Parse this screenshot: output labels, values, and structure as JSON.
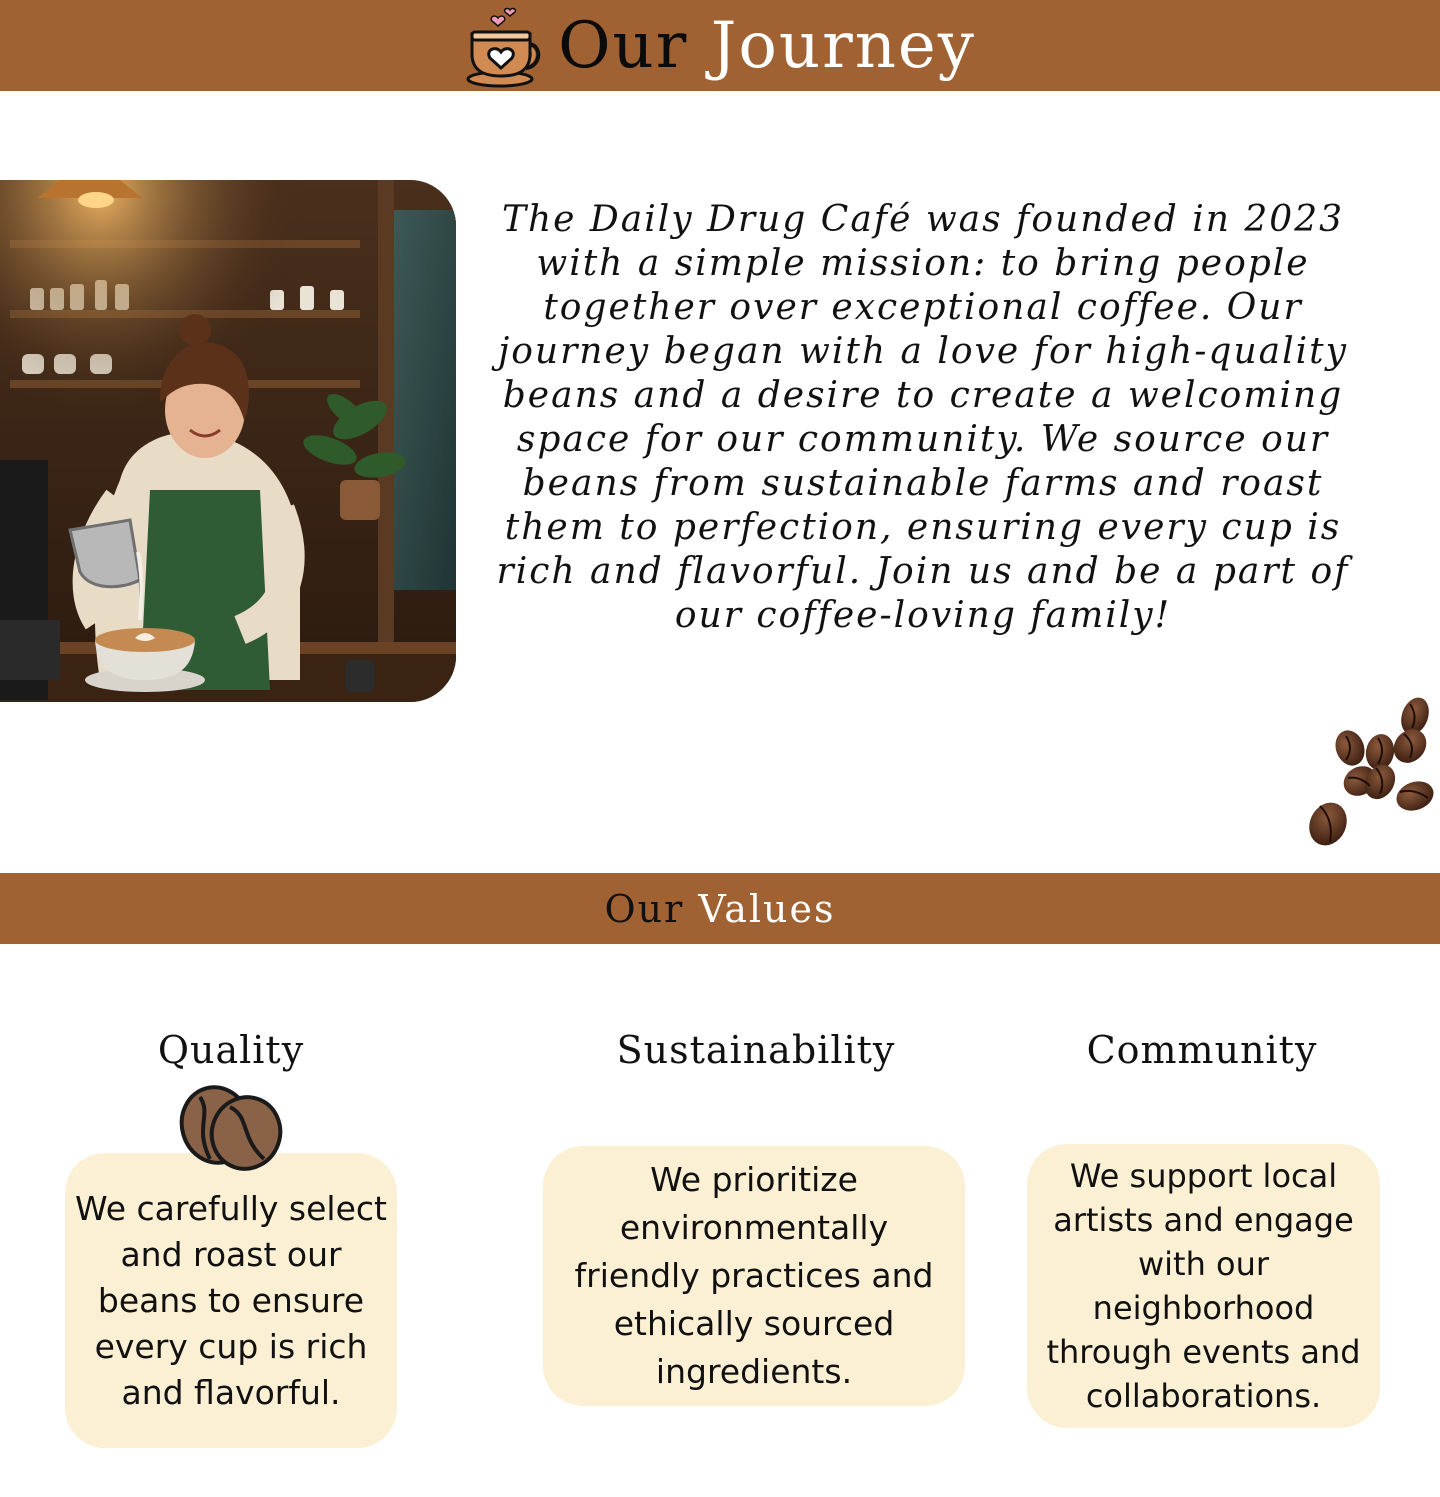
{
  "header": {
    "title_part1": "Our",
    "title_part2": "Journey",
    "logo_icon": "coffee-cup-heart-icon",
    "band_color": "#a06232"
  },
  "journey": {
    "image": "barista-pouring-latte-art",
    "story": "The Daily Drug Café was founded in 2023 with a simple mission: to bring people together over exceptional coffee. Our journey began with a love for high-quality beans and a desire to create a welcoming space for our community. We source our beans from sustainable farms and roast them to perfection, ensuring every cup is rich and flavorful. Join us and be a part of our coffee-loving family!"
  },
  "values_section": {
    "title_part1": "Our",
    "title_part2": "Values",
    "card_color": "#fbf0d4",
    "items": [
      {
        "title": "Quality",
        "icon": "coffee-beans-icon",
        "text": "We carefully select and roast our beans to ensure every cup is rich and flavorful."
      },
      {
        "title": "Sustainability",
        "text": "We prioritize environmentally friendly practices and ethically sourced ingredients."
      },
      {
        "title": "Community",
        "text": "We support local artists and engage with our neighborhood through events and collaborations."
      }
    ]
  }
}
